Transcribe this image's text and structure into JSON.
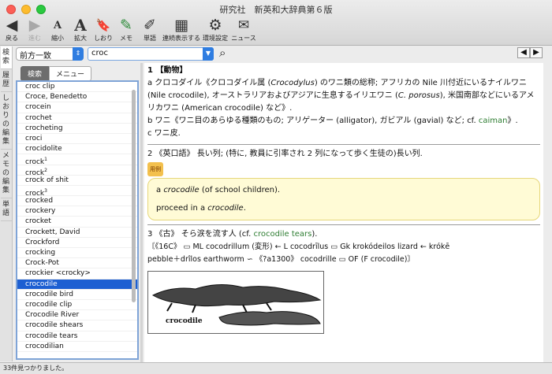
{
  "window": {
    "title": "研究社　新英和大辞典第６版"
  },
  "toolbar": {
    "buttons": [
      {
        "label": "戻る",
        "icon": "◀"
      },
      {
        "label": "進む",
        "icon": "▶"
      },
      {
        "label": "縮小",
        "icon": "A"
      },
      {
        "label": "拡大",
        "icon": "A"
      },
      {
        "label": "しおり",
        "icon": "🔖"
      },
      {
        "label": "メモ",
        "icon": "✎"
      },
      {
        "label": "単語",
        "icon": "✐"
      },
      {
        "label": "連続表示する",
        "icon": "▦"
      },
      {
        "label": "環境設定",
        "icon": "⚙"
      },
      {
        "label": "ニュース",
        "icon": "✉"
      }
    ]
  },
  "vtabs": [
    {
      "label": "検索"
    },
    {
      "label": "履歴"
    },
    {
      "label": "しおりの編集"
    },
    {
      "label": "メモの編集"
    },
    {
      "label": "単語"
    }
  ],
  "search": {
    "mode": "前方一致",
    "query": "croc"
  },
  "segmented": {
    "search": "検索",
    "menu": "メニュー"
  },
  "wordlist": {
    "items": [
      {
        "t": "croc clip"
      },
      {
        "t": "Croce, Benedetto"
      },
      {
        "t": "crocein"
      },
      {
        "t": "crochet"
      },
      {
        "t": "crocheting"
      },
      {
        "t": "croci"
      },
      {
        "t": "crocidolite"
      },
      {
        "t": "crock",
        "s": "1"
      },
      {
        "t": "crock",
        "s": "2"
      },
      {
        "t": "crock of shit"
      },
      {
        "t": "crock",
        "s": "3"
      },
      {
        "t": "crocked"
      },
      {
        "t": "crockery"
      },
      {
        "t": "crocket"
      },
      {
        "t": "Crockett, David"
      },
      {
        "t": "Crockford"
      },
      {
        "t": "crocking"
      },
      {
        "t": "Crock-Pot"
      },
      {
        "t": "crockier <crocky>"
      },
      {
        "t": "crocodile"
      },
      {
        "t": "crocodile bird"
      },
      {
        "t": "crocodile clip"
      },
      {
        "t": "Crocodile River"
      },
      {
        "t": "crocodile shears"
      },
      {
        "t": "crocodile tears"
      },
      {
        "t": "crocodilian"
      }
    ],
    "selected_index": 19
  },
  "entry": {
    "s1_head": "1 【動物】",
    "s1a_1": "a クロコダイル《クロコダイル属 (",
    "s1a_genus": "Crocodylus",
    "s1a_2": ") のワニ類の総称; アフリカの Nile 川付近にいるナイルワニ (Nile crocodile), オーストラリアおよびアジアに生息するイリエワニ (",
    "s1a_porosus": "C. porosus",
    "s1a_3": "), 米国南部などにいるアメリカワニ (American crocodile) など》.",
    "s1b_1": "b ワニ《ワニ目のあらゆる種類のもの; アリゲーター (alligator), ガビアル (gavial) など; cf.",
    "s1b_link": "caiman",
    "s1b_2": "》.",
    "s1c": "c ワニ皮.",
    "s2": "2 《英口語》 長い列; (特に, 教員に引率され 2 列になって歩く生徒の)長い列.",
    "badge": "用例",
    "ex1_1": "a ",
    "ex1_it": "crocodile",
    "ex1_2": " (of school children).",
    "ex2_1": "proceed in a ",
    "ex2_it": "crocodile",
    "ex2_2": ".",
    "s3_1": "3 《古》 そら涙を流す人 (cf. ",
    "s3_link": "crocodile tears",
    "s3_2": ").",
    "etym_line1": "〘《16C》 ▭ ML cocodrillum (変形) ← L cocodrīlus ▭ Gk krokódeilos lizard ← krókē",
    "etym_line2": "pebble＋drîlos earthworm ∽ 《?a1300》 cocodrille ▭ OF (F crocodile)〙",
    "image_caption": "crocodile"
  },
  "status": {
    "text": "33件見つかりました。"
  },
  "colors": {
    "selection": "#1d5fd2",
    "link": "#2e7d32",
    "example_bg": "#fffbd6"
  }
}
